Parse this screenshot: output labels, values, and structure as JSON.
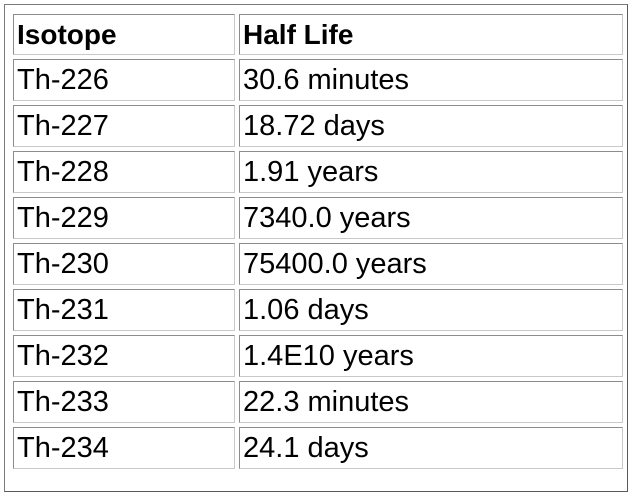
{
  "table": {
    "headers": [
      "Isotope",
      "Half Life"
    ],
    "rows": [
      [
        "Th-226",
        "30.6 minutes"
      ],
      [
        "Th-227",
        "18.72 days"
      ],
      [
        "Th-228",
        "1.91 years"
      ],
      [
        "Th-229",
        "7340.0 years"
      ],
      [
        "Th-230",
        "75400.0 years"
      ],
      [
        "Th-231",
        "1.06 days"
      ],
      [
        "Th-232",
        "1.4E10 years"
      ],
      [
        "Th-233",
        "22.3 minutes"
      ],
      [
        "Th-234",
        "24.1 days"
      ]
    ]
  }
}
